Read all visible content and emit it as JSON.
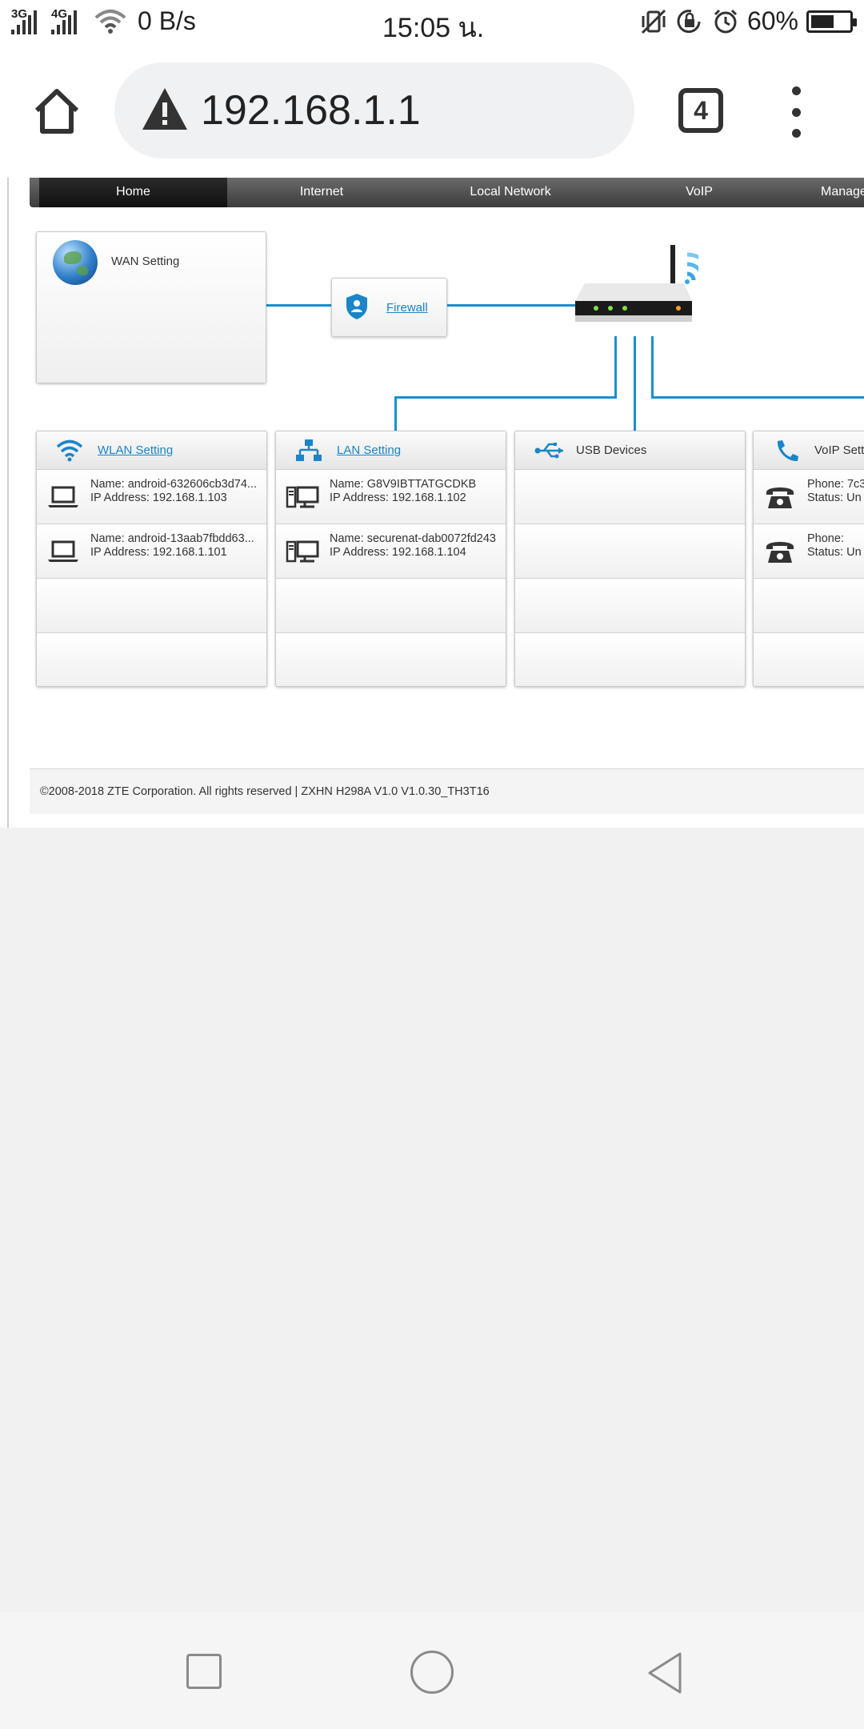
{
  "status_bar": {
    "net_3g": "3G",
    "net_4g": "4G",
    "speed": "0 B/s",
    "time": "15:05 น.",
    "battery": "60%",
    "battery_level": 0.6
  },
  "browser": {
    "url": "192.168.1.1",
    "tab_count": "4"
  },
  "nav": {
    "items": [
      "Home",
      "Internet",
      "Local Network",
      "VoIP",
      "Manage"
    ],
    "active": "Home"
  },
  "topology": {
    "wan_label": "WAN Setting",
    "firewall_label": "Firewall"
  },
  "cards": {
    "wlan": {
      "title": "WLAN Setting",
      "rows": [
        {
          "name": "Name: android-632606cb3d74...",
          "ip": "IP Address: 192.168.1.103"
        },
        {
          "name": "Name: android-13aab7fbdd63...",
          "ip": "IP Address: 192.168.1.101"
        }
      ]
    },
    "lan": {
      "title": "LAN Setting",
      "rows": [
        {
          "name": "Name: G8V9IBTTATGCDKB",
          "ip": "IP Address: 192.168.1.102"
        },
        {
          "name": "Name: securenat-dab0072fd243",
          "ip": "IP Address: 192.168.1.104"
        }
      ]
    },
    "usb": {
      "title": "USB Devices"
    },
    "voip": {
      "title": "VoIP Sett",
      "rows": [
        {
          "name": "Phone: 7c3",
          "ip": "Status: Un"
        },
        {
          "name": "Phone:",
          "ip": "Status: Un"
        }
      ]
    }
  },
  "footer": {
    "text": "©2008-2018 ZTE Corporation. All rights reserved  |   ZXHN H298A V1.0 V1.0.30_TH3T16"
  },
  "colors": {
    "accent": "#1a8fd0",
    "link": "#1a85c8"
  }
}
